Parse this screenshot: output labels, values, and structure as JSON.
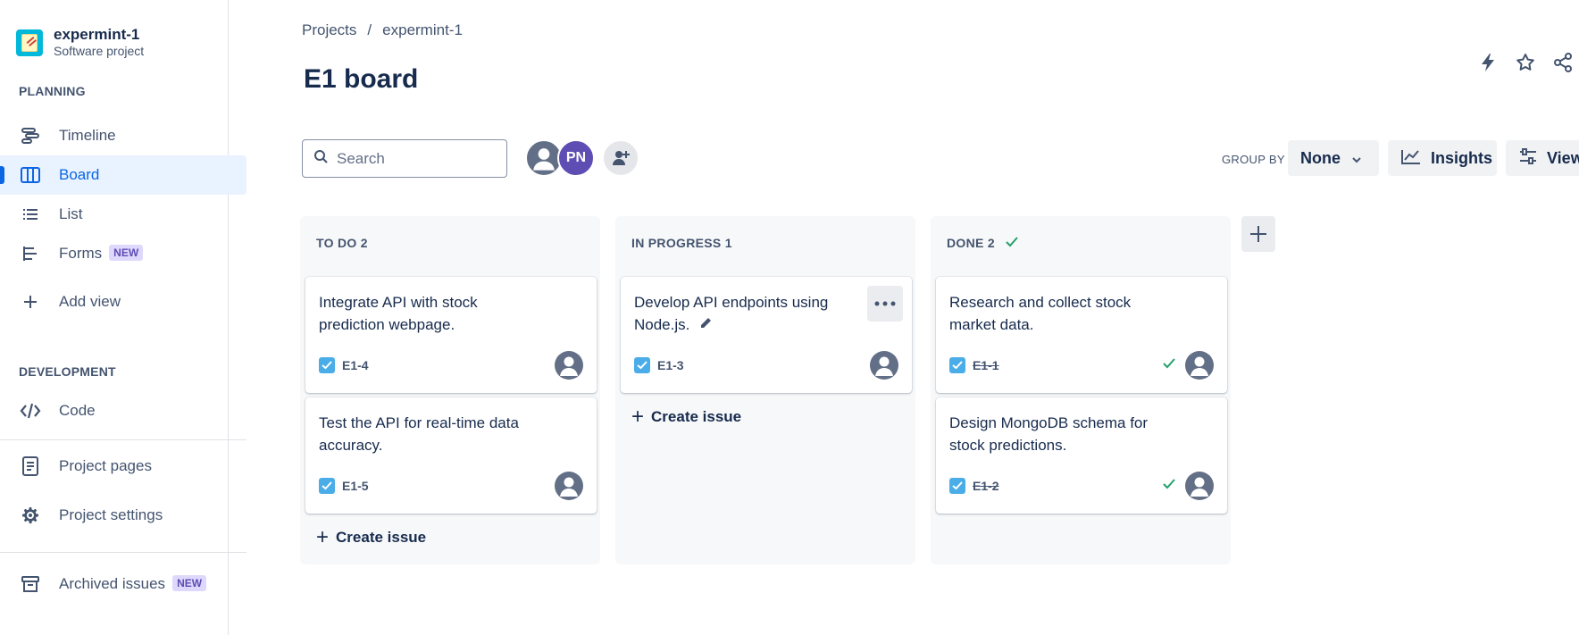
{
  "sidebar": {
    "project_name": "expermint-1",
    "project_type": "Software project",
    "planning_heading": "PLANNING",
    "development_heading": "DEVELOPMENT",
    "items": [
      {
        "label": "Timeline",
        "icon": "timeline-icon"
      },
      {
        "label": "Board",
        "icon": "board-icon",
        "active": true
      },
      {
        "label": "List",
        "icon": "list-icon"
      },
      {
        "label": "Forms",
        "icon": "forms-icon",
        "badge": "NEW"
      },
      {
        "label": "Add view",
        "icon": "plus-icon"
      },
      {
        "label": "Code",
        "icon": "code-icon"
      },
      {
        "label": "Project pages",
        "icon": "pages-icon"
      },
      {
        "label": "Project settings",
        "icon": "gear-icon"
      },
      {
        "label": "Archived issues",
        "icon": "archive-icon",
        "badge": "NEW"
      }
    ]
  },
  "header": {
    "breadcrumb": [
      "Projects",
      "/",
      "expermint-1"
    ],
    "title": "E1 board"
  },
  "toolbar": {
    "search_placeholder": "Search",
    "avatar_initials": "PN",
    "group_by_label": "GROUP BY",
    "group_by_value": "None",
    "insights_label": "Insights",
    "view_label": "View"
  },
  "columns": [
    {
      "title": "TO DO 2",
      "cards": [
        {
          "summary": "Integrate API with stock prediction webpage.",
          "key": "E1-4",
          "done": false
        },
        {
          "summary": "Test the API for real-time data accuracy.",
          "key": "E1-5",
          "done": false
        }
      ],
      "create_label": "Create issue"
    },
    {
      "title": "IN PROGRESS 1",
      "cards": [
        {
          "summary": "Develop API endpoints using Node.js.",
          "key": "E1-3",
          "done": false
        }
      ],
      "create_label": "Create issue"
    },
    {
      "title": "DONE 2",
      "cards": [
        {
          "summary": "Research and collect stock market data.",
          "key": "E1-1",
          "done": true
        },
        {
          "summary": "Design MongoDB schema for stock predictions.",
          "key": "E1-2",
          "done": true
        }
      ]
    }
  ],
  "colors": {
    "accent": "#0c66e4",
    "done_check": "#22a06b",
    "checkbox": "#4bade8"
  }
}
